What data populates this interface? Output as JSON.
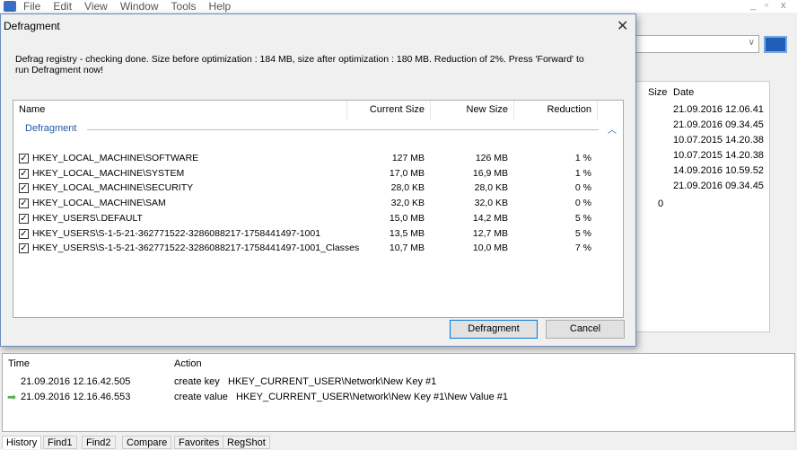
{
  "menu": [
    "File",
    "Edit",
    "View",
    "Window",
    "Tools",
    "Help"
  ],
  "window_controls": [
    "_",
    "▫",
    "x"
  ],
  "right_list": {
    "headers": [
      "Size",
      "Date"
    ],
    "dates": [
      "21.09.2016 12.06.41",
      "21.09.2016 09.34.45",
      "10.07.2015 14.20.38",
      "10.07.2015 14.20.38",
      "14.09.2016 10.59.52",
      "21.09.2016 09.34.45"
    ],
    "size_value": "0"
  },
  "dialog": {
    "title": "Defragment",
    "message": "Defrag registry - checking done. Size before optimization : 184 MB, size after optimization : 180 MB. Reduction of 2%. Press 'Forward' to run Defragment now!",
    "columns": [
      "Name",
      "Current Size",
      "New Size",
      "Reduction"
    ],
    "group": "Defragment",
    "rows": [
      {
        "name": "HKEY_LOCAL_MACHINE\\SOFTWARE",
        "current": "127 MB",
        "new": "126 MB",
        "reduction": "1 %"
      },
      {
        "name": "HKEY_LOCAL_MACHINE\\SYSTEM",
        "current": "17,0 MB",
        "new": "16,9 MB",
        "reduction": "1 %"
      },
      {
        "name": "HKEY_LOCAL_MACHINE\\SECURITY",
        "current": "28,0 KB",
        "new": "28,0 KB",
        "reduction": "0 %"
      },
      {
        "name": "HKEY_LOCAL_MACHINE\\SAM",
        "current": "32,0 KB",
        "new": "32,0 KB",
        "reduction": "0 %"
      },
      {
        "name": "HKEY_USERS\\.DEFAULT",
        "current": "15,0 MB",
        "new": "14,2 MB",
        "reduction": "5 %"
      },
      {
        "name": "HKEY_USERS\\S-1-5-21-362771522-3286088217-1758441497-1001",
        "current": "13,5 MB",
        "new": "12,7 MB",
        "reduction": "5 %"
      },
      {
        "name": "HKEY_USERS\\S-1-5-21-362771522-3286088217-1758441497-1001_Classes",
        "current": "10,7 MB",
        "new": "10,0 MB",
        "reduction": "7 %"
      }
    ],
    "defragment_button": "Defragment",
    "cancel_button": "Cancel"
  },
  "history": {
    "headers": [
      "Time",
      "Action"
    ],
    "rows": [
      {
        "time": "21.09.2016 12.16.42.505",
        "action": "create key",
        "path": "HKEY_CURRENT_USER\\Network\\New Key #1"
      },
      {
        "time": "21.09.2016 12.16.46.553",
        "action": "create value",
        "path": "HKEY_CURRENT_USER\\Network\\New Key #1\\New Value #1"
      }
    ]
  },
  "tabs": [
    "History",
    "Find1",
    "Find2",
    "Compare",
    "Favorites",
    "RegShot"
  ],
  "colors": {
    "accent": "#1e5aa8",
    "arrow": "#4caf50"
  }
}
